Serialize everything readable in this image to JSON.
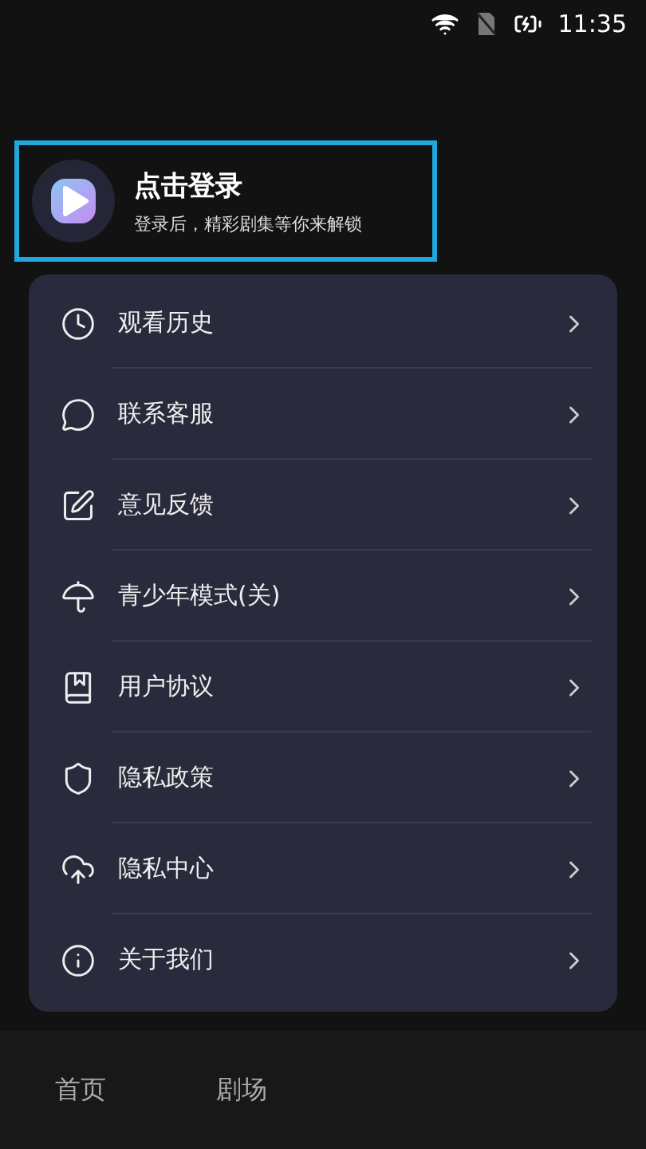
{
  "status_bar": {
    "time": "11:35"
  },
  "login": {
    "title": "点击登录",
    "subtitle": "登录后，精彩剧集等你来解锁"
  },
  "menu": [
    {
      "label": "观看历史"
    },
    {
      "label": "联系客服"
    },
    {
      "label": "意见反馈"
    },
    {
      "label": "青少年模式(关)"
    },
    {
      "label": "用户协议"
    },
    {
      "label": "隐私政策"
    },
    {
      "label": "隐私中心"
    },
    {
      "label": "关于我们"
    }
  ],
  "bottom_nav": [
    {
      "label": "首页"
    },
    {
      "label": "剧场"
    }
  ]
}
